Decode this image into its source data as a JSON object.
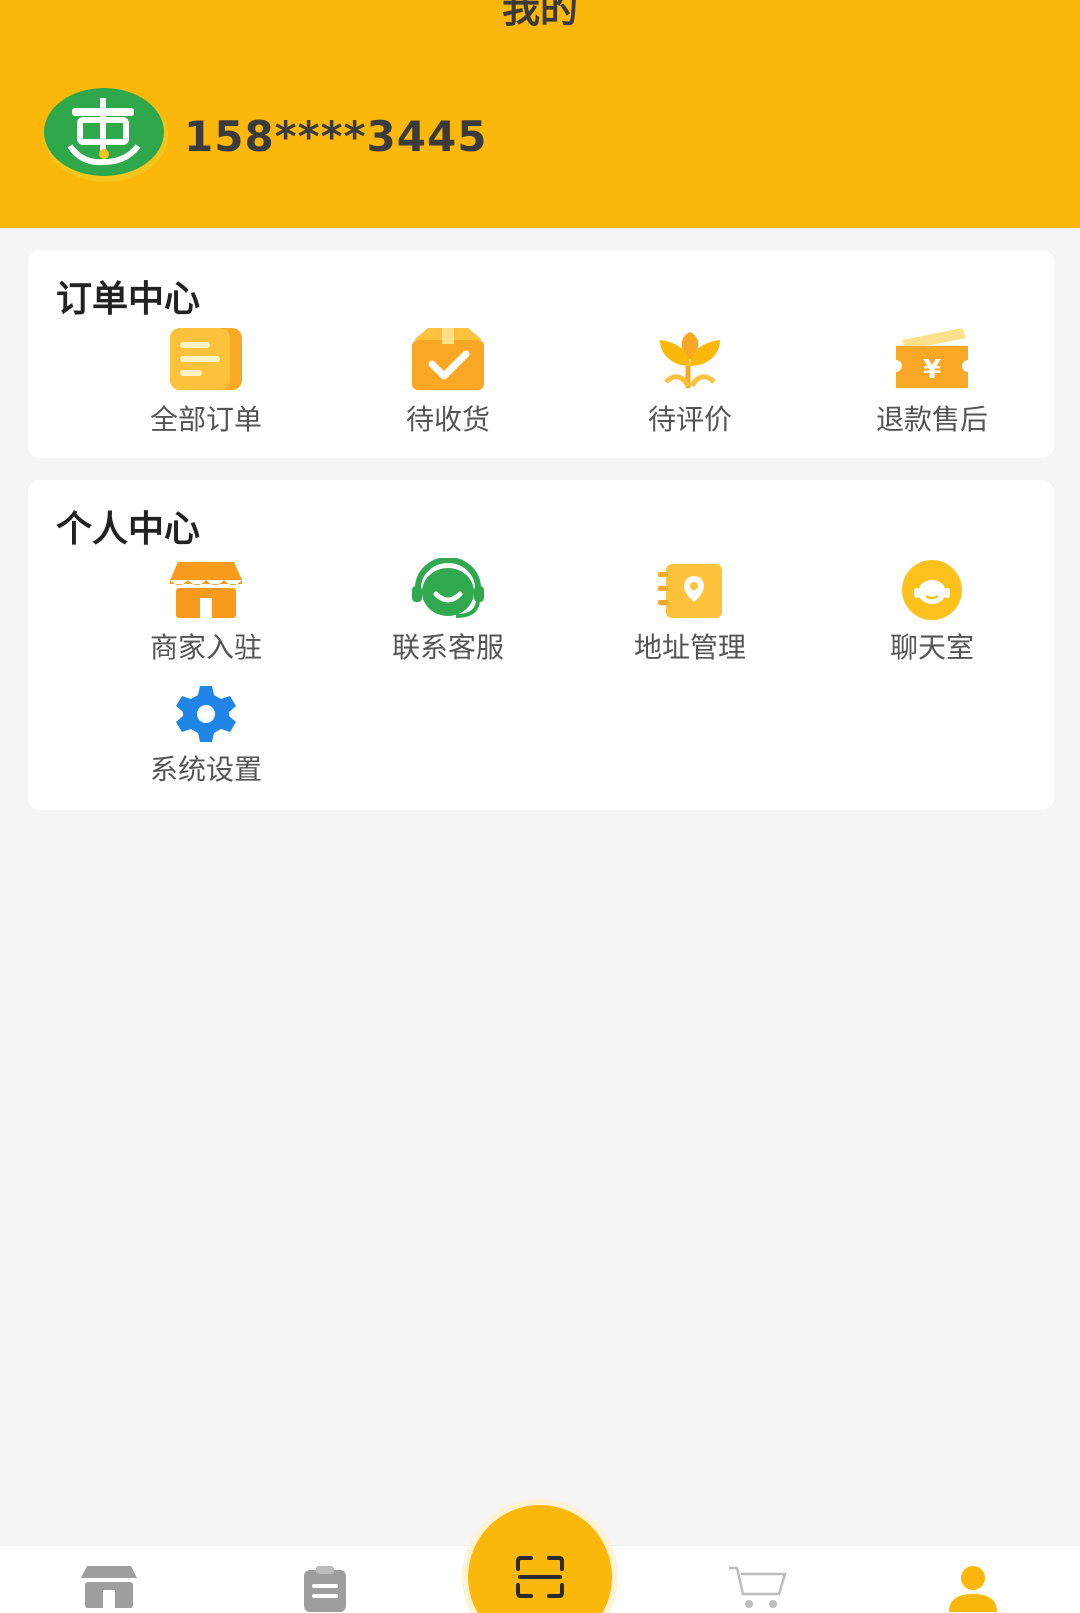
{
  "header": {
    "title": "我的",
    "phone": "158****3445"
  },
  "orders": {
    "title": "订单中心",
    "items": [
      {
        "label": "全部订单",
        "icon": "all-orders-icon"
      },
      {
        "label": "待收货",
        "icon": "pending-receipt-icon"
      },
      {
        "label": "待评价",
        "icon": "pending-review-icon"
      },
      {
        "label": "退款售后",
        "icon": "refund-icon"
      }
    ]
  },
  "personal": {
    "title": "个人中心",
    "items": [
      {
        "label": "商家入驻",
        "icon": "store-icon"
      },
      {
        "label": "联系客服",
        "icon": "customer-service-icon"
      },
      {
        "label": "地址管理",
        "icon": "address-icon"
      },
      {
        "label": "聊天室",
        "icon": "chat-icon"
      },
      {
        "label": "系统设置",
        "icon": "gear-icon"
      }
    ]
  },
  "colors": {
    "brand": "#fcb70b",
    "orange": "#f89b1c",
    "green": "#2fa84f",
    "blue": "#1f86e8"
  }
}
